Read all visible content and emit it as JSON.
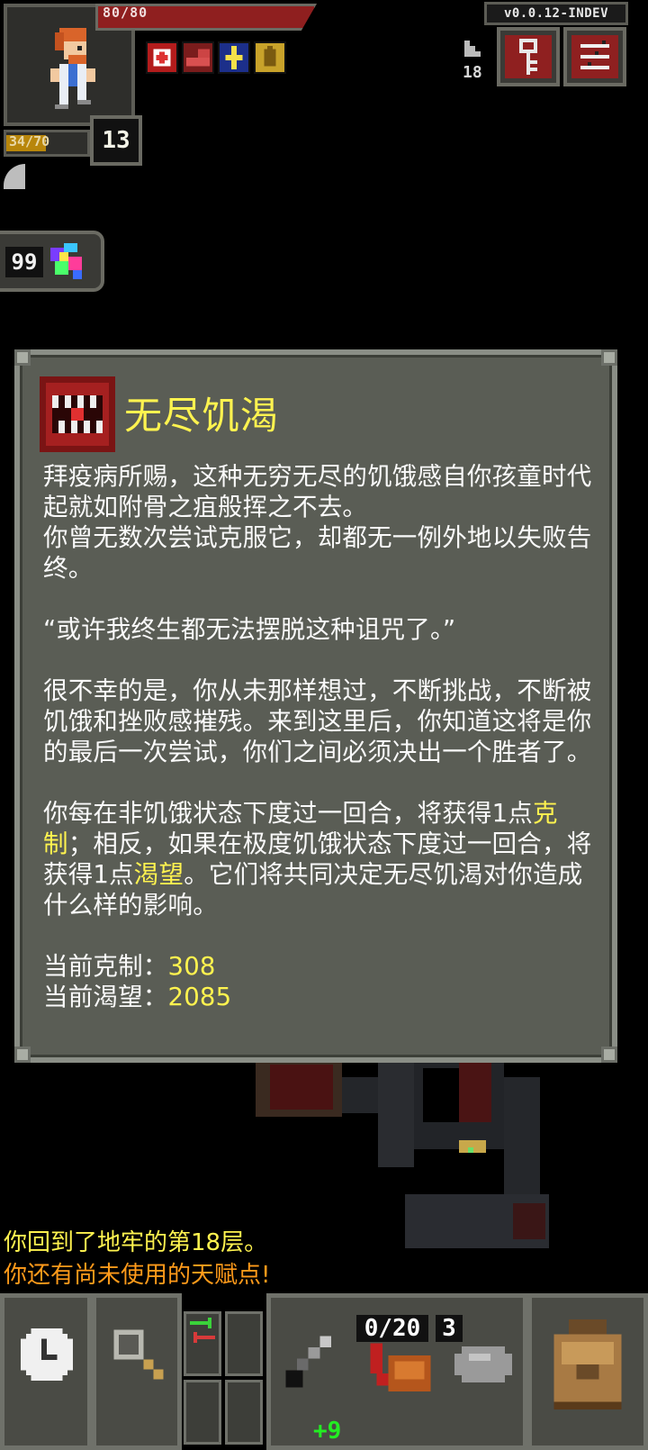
{
  "status": {
    "hp_text": "80/80",
    "hp_fraction": 1.0,
    "exp_text": "34/70",
    "exp_fraction": 0.486,
    "level": "13",
    "buffs": [
      "medkit-buff-icon",
      "hunger-buff-icon",
      "bless-buff-icon",
      "light-buff-icon"
    ]
  },
  "top_right": {
    "version": "v0.0.12-INDEV",
    "depth": "18",
    "journal_icon": "key-icon",
    "menu_icon": "menu-icon"
  },
  "gauge": {
    "value": "99"
  },
  "dialog": {
    "title": "无尽饥渴",
    "p1": "拜疫病所赐，这种无穷无尽的饥饿感自你孩童时代起就如附骨之疽般挥之不去。",
    "p2": "你曾无数次尝试克服它，却都无一例外地以失败告终。",
    "p3": "“或许我终生都无法摆脱这种诅咒了。”",
    "p4": "很不幸的是，你从未那样想过，不断挑战，不断被饥饿和挫败感摧残。来到这里后，你知道这将是你的最后一次尝试，你们之间必须决出一个胜者了。",
    "p5_a": "你每在非饥饿状态下度过一回合，将获得1点",
    "p5_hl1": "克制",
    "p5_b": "；相反，如果在极度饥饿状态下度过一回合，将获得1点",
    "p5_hl2": "渴望",
    "p5_c": "。它们将共同决定无尽饥渴对你造成什么样的影响。",
    "restraint_label": "当前克制：",
    "restraint_value": "308",
    "craving_label": "当前渴望：",
    "craving_value": "2085"
  },
  "log": {
    "line1": "你回到了地牢的第18层。",
    "line2": "你还有尚未使用的天赋点!"
  },
  "toolbar": {
    "wait_icon": "clock-icon",
    "search_icon": "magnifier-icon",
    "swap_icon": "swap-icon",
    "weapon_upgrade": "+9",
    "quickslot_counter": "0/20",
    "quickslot_count2": "3",
    "backpack_icon": "backpack-icon"
  },
  "colors": {
    "highlight": "#fff34f",
    "warning": "#ff9a1a",
    "hp": "#8f1f1f",
    "panel": "#5a5d55"
  }
}
